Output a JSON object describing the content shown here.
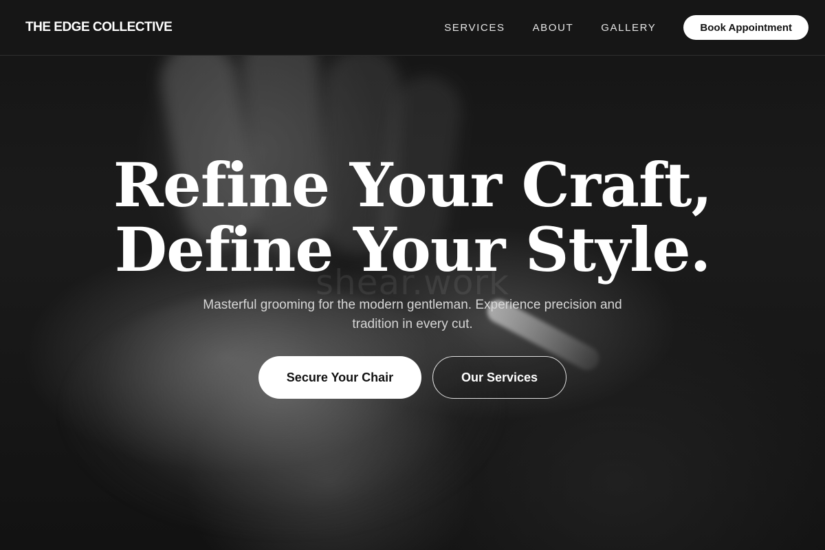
{
  "header": {
    "brand": "THE EDGE COLLECTIVE",
    "nav": [
      {
        "label": "SERVICES"
      },
      {
        "label": "ABOUT"
      },
      {
        "label": "GALLERY"
      }
    ],
    "cta_label": "Book Appointment"
  },
  "hero": {
    "headline_line1": "Refine Your Craft,",
    "headline_line2": "Define Your Style.",
    "watermark": "shear.work",
    "subtext": "Masterful grooming for the modern gentleman. Experience precision and tradition in every cut.",
    "primary_button": "Secure Your Chair",
    "secondary_button": "Our Services"
  },
  "colors": {
    "background": "#0b0b0b",
    "header_bg": "#161616",
    "accent": "#ffffff"
  }
}
